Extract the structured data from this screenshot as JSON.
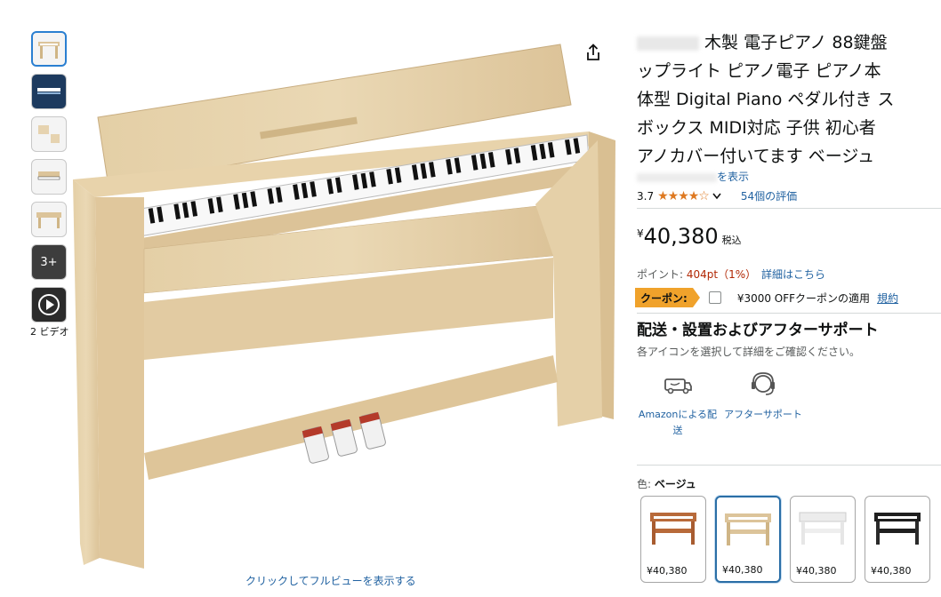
{
  "thumbnails": [
    {
      "kind": "image",
      "name": "thumb-1"
    },
    {
      "kind": "image",
      "name": "thumb-2"
    },
    {
      "kind": "image",
      "name": "thumb-3"
    },
    {
      "kind": "image",
      "name": "thumb-4"
    },
    {
      "kind": "image",
      "name": "thumb-5"
    },
    {
      "kind": "more",
      "label": "3+"
    },
    {
      "kind": "video"
    }
  ],
  "video_label": "2 ビデオ",
  "fullview_link": "クリックしてフルビューを表示する",
  "title": {
    "line1": "木製 電子ピアノ 88鍵盤",
    "line2": "ップライト ピアノ電子 ピアノ本",
    "line3": "体型 Digital Piano ペダル付き ス",
    "line4": "ボックス MIDI対応 子供 初心者",
    "line5": "アノカバー付いてます ベージュ"
  },
  "brand_suffix": "を表示",
  "rating": {
    "value": "3.7",
    "stars": "★★★★☆",
    "reviews": "54個の評価"
  },
  "price": {
    "symbol": "¥",
    "amount": "40,380",
    "tax": "税込"
  },
  "points": {
    "label": "ポイント:",
    "value": "404pt（1%）",
    "link": "詳細はこちら"
  },
  "coupon": {
    "badge": "クーポン:",
    "text": "¥3000 OFFクーポンの適用",
    "link": "規約"
  },
  "support": {
    "heading": "配送・設置およびアフターサポート",
    "subtext": "各アイコンを選択して詳細をご確認ください。",
    "items": [
      {
        "icon": "truck-icon",
        "label": "Amazonによる配送"
      },
      {
        "icon": "headset-icon",
        "label": "アフターサポート"
      }
    ]
  },
  "color": {
    "label": "色:",
    "value": "ベージュ"
  },
  "swatches": [
    {
      "name": "brown",
      "price": "¥40,380",
      "color": "#b86a3a"
    },
    {
      "name": "beige",
      "price": "¥40,380",
      "color": "#dcc49a"
    },
    {
      "name": "white",
      "price": "¥40,380",
      "color": "#f4f4f4"
    },
    {
      "name": "black",
      "price": "¥40,380",
      "color": "#1f1f1f"
    }
  ],
  "colors": {
    "link": "#2162a1",
    "accent": "#de7921",
    "coupon": "#f0a22b",
    "selected": "#2a6ea6"
  }
}
